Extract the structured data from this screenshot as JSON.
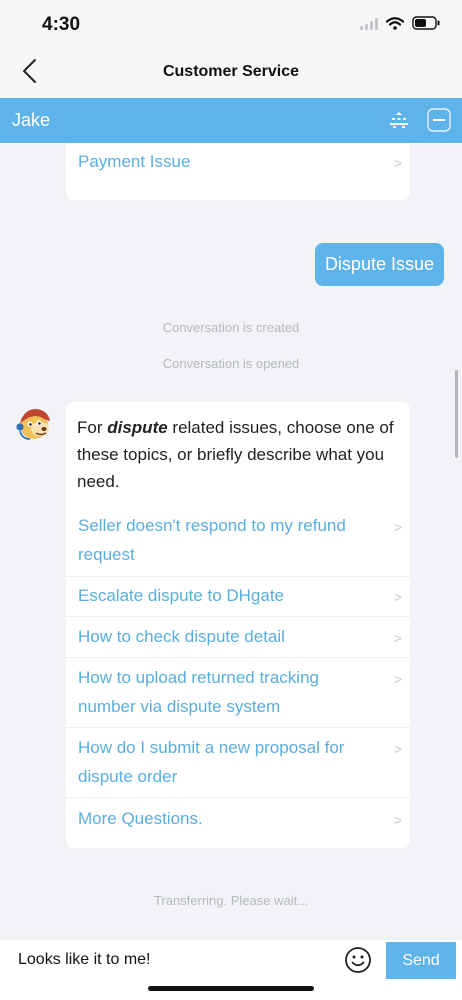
{
  "status_bar": {
    "time": "4:30",
    "icons": [
      "signal-icon",
      "wifi-icon",
      "battery-icon"
    ]
  },
  "nav": {
    "back_icon": "chevron-left-icon",
    "title": "Customer Service"
  },
  "agent_bar": {
    "name": "Jake",
    "tools": [
      "tray-icon",
      "minimize-icon"
    ]
  },
  "chat": {
    "previous_topic": {
      "label": "Payment Issue"
    },
    "user_message": "Dispute Issue",
    "system_messages": {
      "created": "Conversation is created",
      "opened": "Conversation is opened",
      "transferring": "Transferring. Please wait..."
    },
    "bot_message": {
      "prefix": "For ",
      "keyword": "dispute",
      "suffix": " related issues, choose one of these topics, or briefly describe what you need.",
      "topics": [
        {
          "label": "Seller doesn't respond to my refund request"
        },
        {
          "label": "Escalate dispute to DHgate"
        },
        {
          "label": "How to check dispute detail"
        },
        {
          "label": "How to upload returned tracking number via dispute system"
        },
        {
          "label": "How do I submit a new proposal for dispute order"
        },
        {
          "label": "More Questions."
        }
      ]
    }
  },
  "input": {
    "value": "Looks like it to me!",
    "emoji_icon": "smiley-icon",
    "send_label": "Send"
  },
  "colors": {
    "accent": "#5eb3ea",
    "link": "#5aaede",
    "background": "#f1f3f7"
  }
}
